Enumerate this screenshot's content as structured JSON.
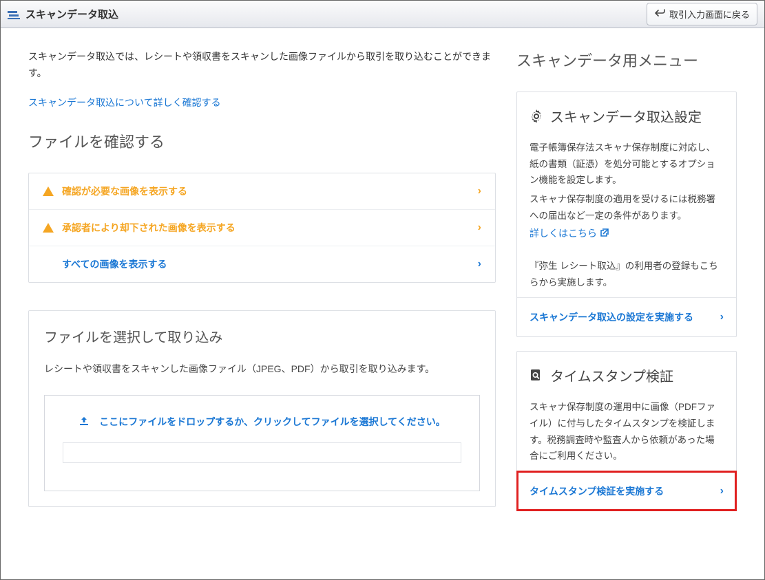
{
  "topbar": {
    "title": "スキャンデータ取込",
    "back_label": "取引入力画面に戻る"
  },
  "intro": {
    "text": "スキャンデータ取込では、レシートや領収書をスキャンした画像ファイルから取引を取り込むことができます。",
    "link": "スキャンデータ取込について詳しく確認する"
  },
  "files_section": {
    "heading": "ファイルを確認する",
    "rows": [
      {
        "label": "確認が必要な画像を表示する",
        "type": "warn"
      },
      {
        "label": "承認者により却下された画像を表示する",
        "type": "warn"
      },
      {
        "label": "すべての画像を表示する",
        "type": "plain"
      }
    ]
  },
  "import_panel": {
    "heading": "ファイルを選択して取り込み",
    "desc": "レシートや領収書をスキャンした画像ファイル（JPEG、PDF）から取引を取り込みます。",
    "drop_label": "ここにファイルをドロップするか、クリックしてファイルを選択してください。"
  },
  "side": {
    "heading": "スキャンデータ用メニュー",
    "settings": {
      "title": "スキャンデータ取込設定",
      "desc1": "電子帳簿保存法スキャナ保存制度に対応し、紙の書類（証憑）を処分可能とするオプション機能を設定します。",
      "desc2": "スキャナ保存制度の適用を受けるには税務署への届出など一定の条件があります。",
      "more_link": "詳しくはこちら",
      "desc3": "『弥生 レシート取込』の利用者の登録もこちらから実施します。",
      "action": "スキャンデータ取込の設定を実施する"
    },
    "timestamp": {
      "title": "タイムスタンプ検証",
      "desc": "スキャナ保存制度の運用中に画像（PDFファイル）に付与したタイムスタンプを検証します。税務調査時や監査人から依頼があった場合にご利用ください。",
      "action": "タイムスタンプ検証を実施する"
    }
  }
}
